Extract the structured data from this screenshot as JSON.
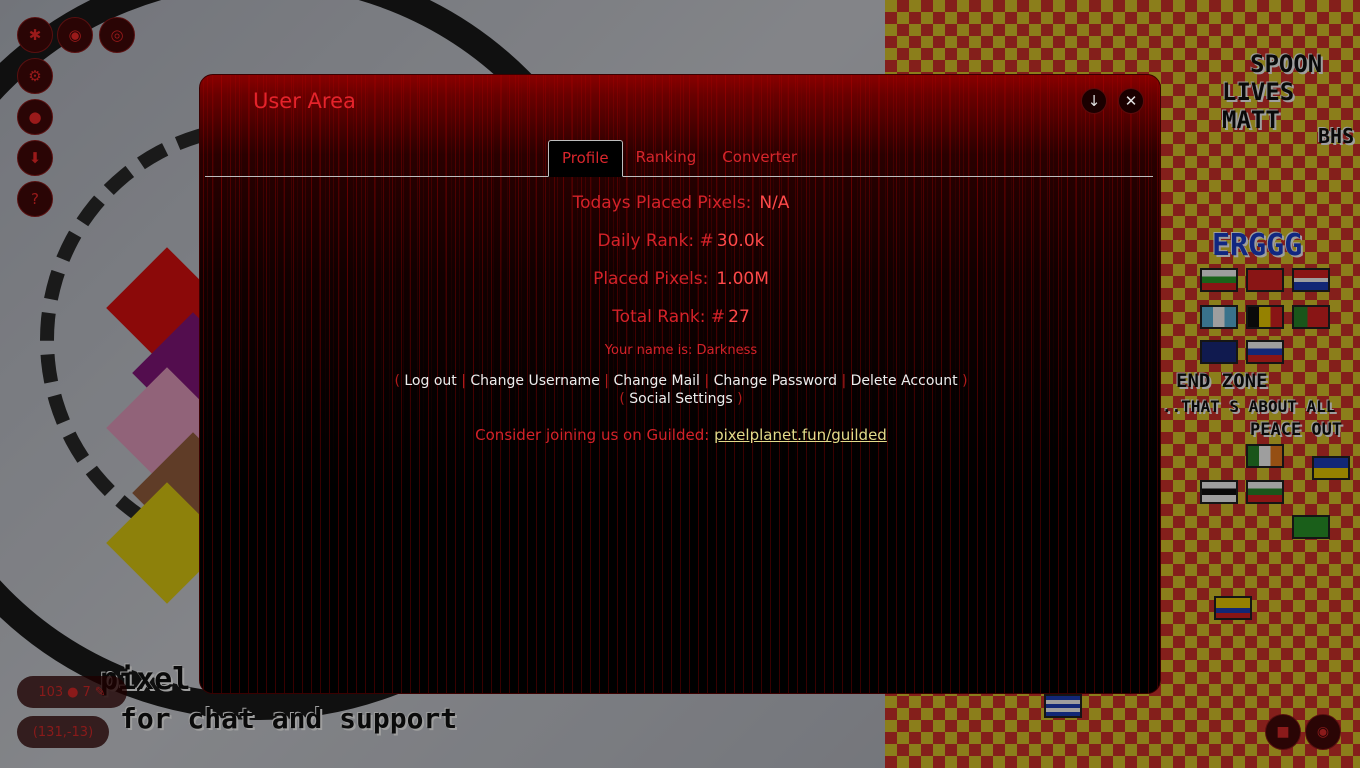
{
  "window": {
    "title": "User Area",
    "minimize_icon": "↓",
    "close_icon": "✕"
  },
  "tabs": [
    {
      "label": "Profile",
      "active": true
    },
    {
      "label": "Ranking",
      "active": false
    },
    {
      "label": "Converter",
      "active": false
    }
  ],
  "profile": {
    "todays_placed_label": "Todays Placed Pixels:",
    "todays_placed_value": "N/A",
    "daily_rank_label": "Daily Rank: #",
    "daily_rank_value": "30.0k",
    "placed_pixels_label": "Placed Pixels:",
    "placed_pixels_value": "1.00M",
    "total_rank_label": "Total Rank: #",
    "total_rank_value": "27",
    "username_line": "Your name is: Darkness"
  },
  "actions": {
    "open_paren": "(",
    "close_paren": ")",
    "sep": "|",
    "log_out": "Log out",
    "change_username": "Change Username",
    "change_mail": "Change Mail",
    "change_password": "Change Password",
    "delete_account": "Delete Account",
    "social_settings": "Social Settings"
  },
  "guilded": {
    "text": "Consider joining us on Guilded:",
    "link": "pixelplanet.fun/guilded"
  },
  "status": {
    "online_count": "103",
    "pixels_count": "7",
    "coordinates": "(131,-13)"
  },
  "canvas_text": {
    "banner_line1": "pixel",
    "banner_line2": "for chat and support",
    "spoon": "SPOON",
    "lives": "LIVES MATT",
    "ergg": "ERGGG",
    "bhs": "BHS",
    "end_zone": "END ZONE",
    "thats_about": "..THAT S ABOUT ALL",
    "peace": "PEACE OUT"
  },
  "colors": {
    "accent_red": "#d42229",
    "link_yellow": "#e3db8a"
  }
}
